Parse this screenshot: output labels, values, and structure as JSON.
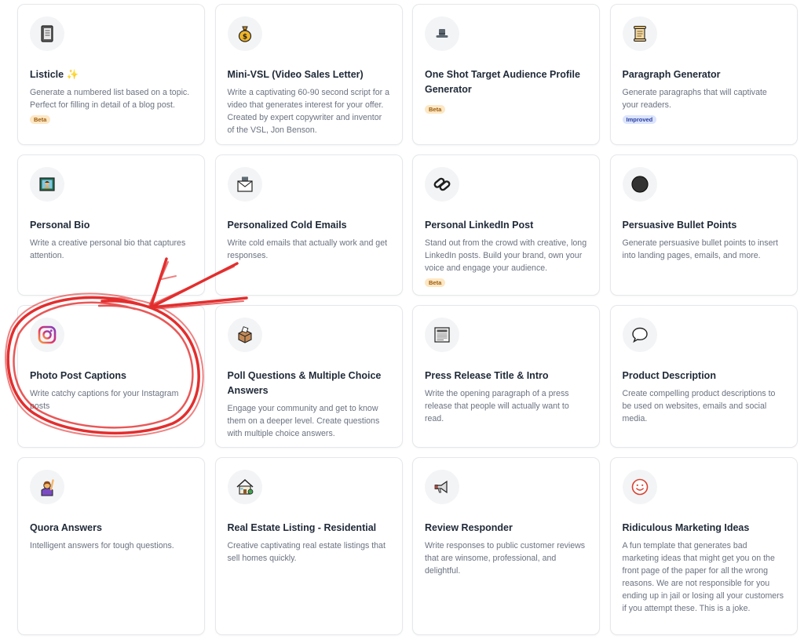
{
  "colors": {
    "card_border": "#e5e7eb",
    "icon_bg": "#f3f4f6",
    "title": "#1f2937",
    "description": "#6b7280",
    "beta_bg": "#fde7c4",
    "improved_bg": "#dbe4ff",
    "annotation_red": "#e01818"
  },
  "cards": [
    {
      "icon": "notebook-icon",
      "title": "Listicle ✨",
      "description": "Generate a numbered list based on a topic. Perfect for filling in detail of a blog post.",
      "badge": "Beta"
    },
    {
      "icon": "money-bag-icon",
      "title": "Mini-VSL (Video Sales Letter)",
      "description": "Write a captivating 60-90 second script for a video that generates interest for your offer. Created by expert copywriter and inventor of the VSL, Jon Benson."
    },
    {
      "icon": "top-hat-icon",
      "title": "One Shot Target Audience Profile Generator",
      "description": "",
      "badge": "Beta"
    },
    {
      "icon": "scroll-icon",
      "title": "Paragraph Generator",
      "description": "Generate paragraphs that will captivate your readers.",
      "badge": "Improved"
    },
    {
      "icon": "framed-portrait-icon",
      "title": "Personal Bio",
      "description": "Write a creative personal bio that captures attention."
    },
    {
      "icon": "envelope-icon",
      "title": "Personalized Cold Emails",
      "description": "Write cold emails that actually work and get responses."
    },
    {
      "icon": "paperclips-icon",
      "title": "Personal LinkedIn Post",
      "description": "Stand out from the crowd with creative, long LinkedIn posts. Build your brand, own your voice and engage your audience.",
      "badge": "Beta"
    },
    {
      "icon": "black-circle-icon",
      "title": "Persuasive Bullet Points",
      "description": "Generate persuasive bullet points to insert into landing pages, emails, and more."
    },
    {
      "icon": "instagram-icon",
      "title": "Photo Post Captions",
      "description": "Write catchy captions for your Instagram posts"
    },
    {
      "icon": "ballot-box-icon",
      "title": "Poll Questions & Multiple Choice Answers",
      "description": "Engage your community and get to know them on a deeper level. Create questions with multiple choice answers."
    },
    {
      "icon": "newspaper-icon",
      "title": "Press Release Title & Intro",
      "description": "Write the opening paragraph of a press release that people will actually want to read."
    },
    {
      "icon": "speech-bubble-icon",
      "title": "Product Description",
      "description": "Create compelling product descriptions to be used on websites, emails and social media."
    },
    {
      "icon": "person-raising-hand-icon",
      "title": "Quora Answers",
      "description": "Intelligent answers for tough questions."
    },
    {
      "icon": "house-icon",
      "title": "Real Estate Listing - Residential",
      "description": "Creative captivating real estate listings that sell homes quickly."
    },
    {
      "icon": "megaphone-icon",
      "title": "Review Responder",
      "description": "Write responses to public customer reviews that are winsome, professional, and delightful."
    },
    {
      "icon": "smiley-icon",
      "title": "Ridiculous Marketing Ideas",
      "description": "A fun template that generates bad marketing ideas that might get you on the front page of the paper for all the wrong reasons. We are not responsible for you ending up in jail or losing all your customers if you attempt these. This is a joke."
    }
  ]
}
